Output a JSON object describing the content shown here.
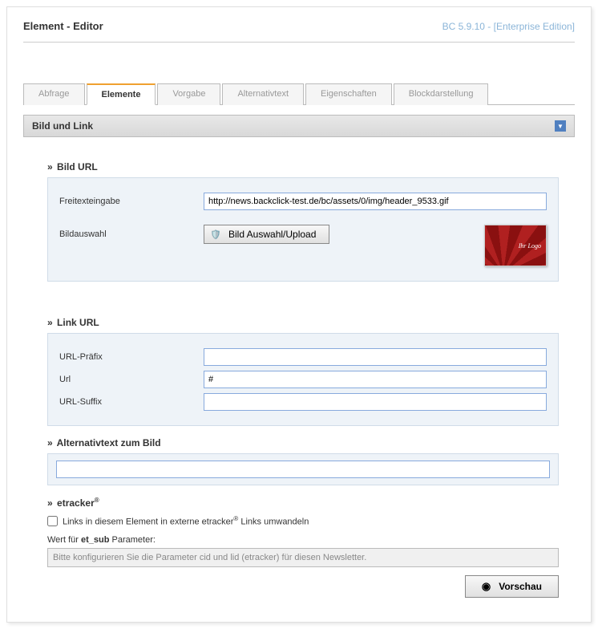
{
  "header": {
    "title": "Element - Editor",
    "version": "BC 5.9.10 - [Enterprise Edition]"
  },
  "tabs": {
    "t0": "Abfrage",
    "t1": "Elemente",
    "t2": "Vorgabe",
    "t3": "Alternativtext",
    "t4": "Eigenschaften",
    "t5": "Blockdarstellung"
  },
  "section": {
    "title": "Bild und Link"
  },
  "bildurl": {
    "heading": "Bild URL",
    "freitext_label": "Freitexteingabe",
    "freitext_value": "http://news.backclick-test.de/bc/assets/0/img/header_9533.gif",
    "auswahl_label": "Bildauswahl",
    "button": "Bild Auswahl/Upload",
    "thumb_text": "Ihr Logo"
  },
  "linkurl": {
    "heading": "Link URL",
    "prefix_label": "URL-Präfix",
    "prefix_value": "",
    "url_label": "Url",
    "url_value": "#",
    "suffix_label": "URL-Suffix",
    "suffix_value": ""
  },
  "alttext": {
    "heading": "Alternativtext zum Bild",
    "value": ""
  },
  "etracker": {
    "heading_pre": "etracker",
    "checkbox_pre": "Links in diesem Element in externe etracker",
    "checkbox_post": " Links umwandeln",
    "param_label_pre": "Wert für ",
    "param_label_b": "et_sub",
    "param_label_post": " Parameter:",
    "param_placeholder": "Bitte konfigurieren Sie die Parameter cid und lid (etracker) für diesen Newsletter."
  },
  "footer": {
    "preview": "Vorschau"
  }
}
